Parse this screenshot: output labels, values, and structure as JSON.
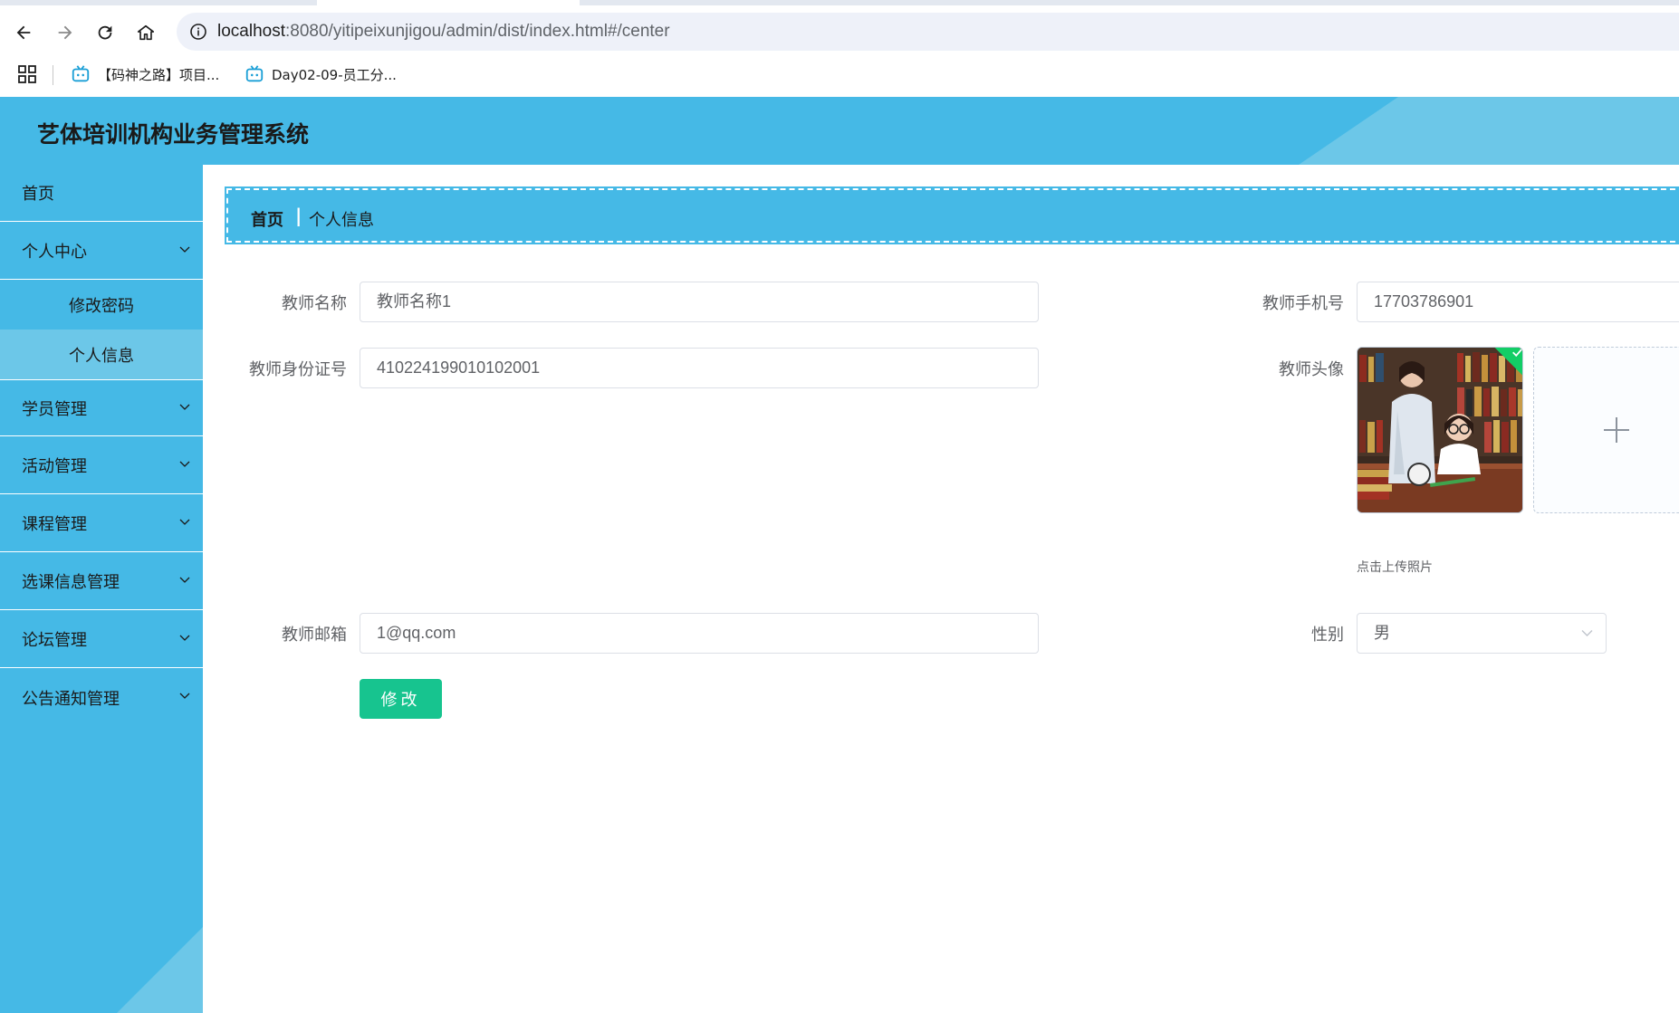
{
  "browser": {
    "url_host": "localhost",
    "url_rest": ":8080/yitipeixunjigou/admin/dist/index.html#/center",
    "bookmarks": [
      {
        "label": "【码神之路】项目..."
      },
      {
        "label": "Day02-09-员工分..."
      }
    ]
  },
  "header": {
    "title": "艺体培训机构业务管理系统"
  },
  "sidebar": {
    "items": [
      {
        "label": "首页"
      },
      {
        "label": "个人中心"
      },
      {
        "label": "修改密码"
      },
      {
        "label": "个人信息"
      },
      {
        "label": "学员管理"
      },
      {
        "label": "活动管理"
      },
      {
        "label": "课程管理"
      },
      {
        "label": "选课信息管理"
      },
      {
        "label": "论坛管理"
      },
      {
        "label": "公告通知管理"
      }
    ]
  },
  "breadcrumb": {
    "home": "首页",
    "separator": "|",
    "current": "个人信息"
  },
  "form": {
    "name_label": "教师名称",
    "name_value": "教师名称1",
    "phone_label": "教师手机号",
    "phone_value": "17703786901",
    "idcard_label": "教师身份证号",
    "idcard_value": "410224199010102001",
    "avatar_label": "教师头像",
    "upload_tip": "点击上传照片",
    "email_label": "教师邮箱",
    "email_value": "1@qq.com",
    "gender_label": "性别",
    "gender_value": "男",
    "submit_label": "修改"
  },
  "colors": {
    "primary": "#45b9e6",
    "accent_light": "#6cc7e8",
    "submit": "#17c48f"
  },
  "icons": [
    "back-icon",
    "forward-icon",
    "reload-icon",
    "home-icon",
    "info-icon",
    "apps-icon",
    "bilibili-icon",
    "chevron-down-icon",
    "check-icon",
    "plus-icon"
  ]
}
